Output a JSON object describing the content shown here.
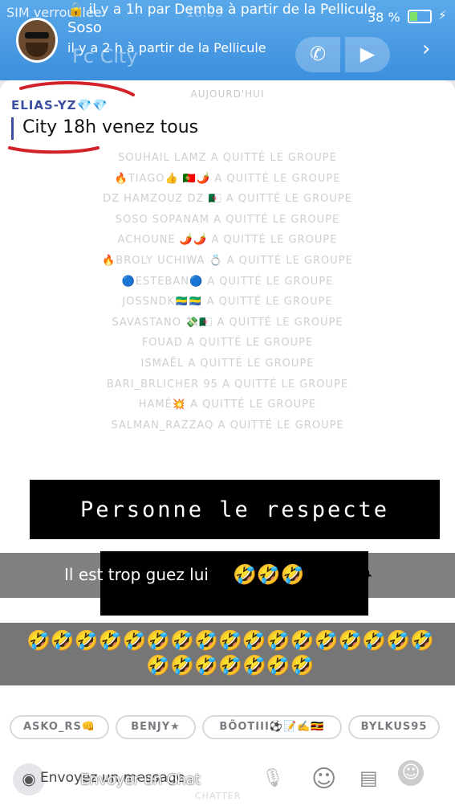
{
  "status": {
    "left": "SIM verrouillée",
    "time": "18:09",
    "battery": "38 %"
  },
  "notification": {
    "line1": "il y a 1h par Demba à partir de la Pellicule",
    "name": "Soso",
    "line2": "il y a 2 h à partir de la Pellicule"
  },
  "header": {
    "group_title": "Fc City"
  },
  "chat": {
    "day_label": "AUJOURD'HUI",
    "sender": "ELIAS-YZ",
    "sender_emoji": "💎💎",
    "message": "City 18h venez tous",
    "left_messages": [
      "SOUHAIL LAMZ A QUITTÉ LE GROUPE",
      "🔥TIAGO👍 🇵🇹🌶️ A QUITTÉ LE GROUPE",
      "DZ HAMZOUZ DZ 🇩🇿 A QUITTÉ LE GROUPE",
      "SOSO SOPANAM A QUITTÉ LE GROUPE",
      "ACHOUNE 🌶️🌶️ A QUITTÉ LE GROUPE",
      "🔥BROLY UCHIWA 💍 A QUITTÉ LE GROUPE",
      "🔵ESTEBAN🔵 A QUITTÉ LE GROUPE",
      "JOSSNDK🇬🇦🇬🇦 A QUITTÉ LE GROUPE",
      "SAVASTANO 💸🇩🇿 A QUITTÉ LE GROUPE",
      "FOUAD A QUITTÉ LE GROUPE",
      "ISMAËL A QUITTÉ LE GROUPE",
      "BARI_BRLICHER 95 A QUITTÉ LE GROUPE",
      "HAMÉ💥 A QUITTÉ LE GROUPE",
      "SALMAN_RAZZAQ A QUITTÉ LE GROUPE"
    ]
  },
  "overlays": {
    "caption1": "Personne le respecte",
    "caption2": "Il est trop guez lui",
    "emojis1": "🤣🤣🤣😂😂😂",
    "emojis2": "🤣🤣🤣🤣🤣🤣🤣🤣🤣🤣🤣🤣🤣🤣🤣🤣🤣🤣🤣🤣🤣🤣🤣🤣"
  },
  "chips": [
    "ASKO_RS👊",
    "BENJY★",
    "BÖOTIII⚽📝✍️🇺🇬",
    "BYLKUS95"
  ],
  "bottom": {
    "input_placeholder": "Envoyez un message",
    "overlay_text": "Envoyer un Chat",
    "chatter_label": "CHATTER"
  },
  "icons": {
    "phone": "phone-icon",
    "video": "video-camera-icon",
    "more": "more-icon",
    "camera": "camera-icon",
    "mic": "microphone-icon",
    "smiley": "smiley-icon",
    "cards": "stickers-icon",
    "rocket": "rocket-icon"
  },
  "colors": {
    "header_blue": "#4a9be3",
    "sender_blue": "#3e4ea0",
    "diamond": "#3bb4f2",
    "annotation_red": "#d2232a"
  }
}
